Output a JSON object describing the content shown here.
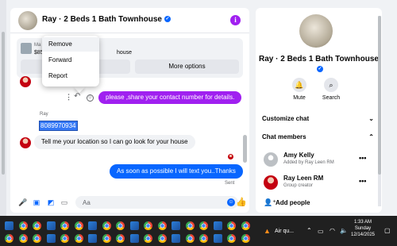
{
  "chat": {
    "title": "Ray · 2 Beds 1 Bath Townhouse",
    "listing": {
      "seller_abbrev": "Ma",
      "price": "$85",
      "title_tail": "house",
      "more_options_label": "More options"
    },
    "context_menu": [
      "Remove",
      "Forward",
      "Report"
    ],
    "messages": {
      "outgoing_1": "please ,share your contact  number for details.",
      "sender_name": "Ray",
      "phone": "8089970934",
      "incoming_1": "Tell me your location so I can go look for your house",
      "outgoing_2": "As soon as possible I will text you..Thanks",
      "sent_status": "Sent"
    },
    "composer_placeholder": "Aa"
  },
  "info_panel": {
    "title": "Ray · 2 Beds 1 Bath Townhouse",
    "mute_label": "Mute",
    "search_label": "Search",
    "customize_chat": "Customize chat",
    "chat_members": "Chat members",
    "members": [
      {
        "name": "Amy Kelly",
        "sub": "Added by Ray Leen RM"
      },
      {
        "name": "Ray Leen RM",
        "sub": "Group creator"
      }
    ],
    "add_people": "Add people"
  },
  "taskbar": {
    "weather_text": "Air qu...",
    "time": "1:33 AM",
    "day": "Sunday",
    "date": "12/14/2025"
  },
  "colors": {
    "accent_purple": "#a020f0",
    "messenger_blue": "#0866ff",
    "background": "#f0f2f5",
    "taskbar": "#202020"
  }
}
